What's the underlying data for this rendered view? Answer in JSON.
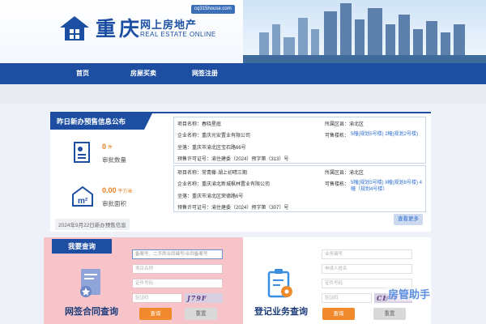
{
  "header": {
    "domain": "cq315house.com",
    "logo_cn": "重庆",
    "logo_sub_cn": "网上房地产",
    "logo_sub_en": "REAL ESTATE ONLINE"
  },
  "nav": {
    "items": [
      {
        "label": "首页"
      },
      {
        "label": "房屋买卖"
      },
      {
        "label": "网签注册"
      }
    ],
    "background": "#1d4ea2"
  },
  "presale": {
    "title": "昨日新办预售信息公布",
    "count_value": "0",
    "count_unit": "件",
    "count_label": "审批数量",
    "area_value": "0.00",
    "area_unit": "平方米",
    "area_label": "审批面积",
    "date_note": "2024年9月22日新办预售信息",
    "more_label": "查看更多",
    "cards": [
      {
        "project": "项目名称：春晓星庭",
        "region": "所属区县：渝北区",
        "company": "企业名称：重庆光安置业有限公司",
        "saleable_label": "可售楼栋：",
        "saleable_value": "5幢(规划5号楼)   2幢(规划2号楼)",
        "address": "坐落：重庆市渝北区宝石路66号",
        "permit": "预售许可证号：渝住建委（2024）预字第（313）号"
      },
      {
        "project": "项目名称：常青藤·湖上初晴三期",
        "region": "所属区县：渝北区",
        "company": "企业名称：重庆渝北新城枫林置业有限公司",
        "saleable_label": "可售楼栋：",
        "saleable_value": "5幢(规划5号楼)  8幢(规划8号楼)  4幢（规划4号楼）",
        "address": "坐落：重庆市渝北区荣德路6号",
        "permit": "预售许可证号：渝住建委（2024）预字第（307）号"
      }
    ]
  },
  "query": {
    "title": "我要查询",
    "left_label": "网签合同查询",
    "right_label": "登记业务查询",
    "left_inputs": [
      "备案号、二手房合同编号/合同备案号",
      "项目名称",
      "证件号码",
      "验证码"
    ],
    "right_inputs": [
      "业务编号",
      "申请人姓名",
      "证件号码",
      "验证码"
    ],
    "captcha_left": "J79F",
    "captcha_right": "CHM",
    "submit_label": "查询",
    "reset_label": "重置"
  },
  "watermark": "房管助手"
}
